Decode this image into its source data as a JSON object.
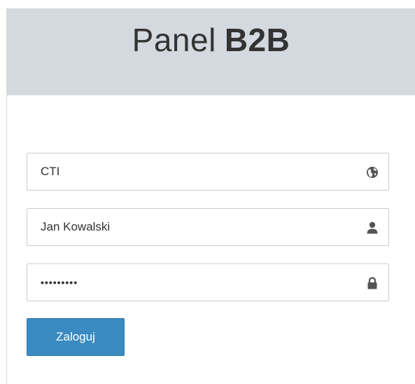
{
  "header": {
    "title_light": "Panel",
    "title_strong": "B2B"
  },
  "form": {
    "company": {
      "value": "CTI",
      "icon": "globe-icon"
    },
    "username": {
      "value": "Jan Kowalski",
      "icon": "user-icon"
    },
    "password": {
      "value": "•••••••••",
      "icon": "lock-icon"
    },
    "submit_label": "Zaloguj"
  },
  "colors": {
    "header_bg": "#d4d8df",
    "button_bg": "#3a8bc1",
    "icon": "#555555"
  }
}
